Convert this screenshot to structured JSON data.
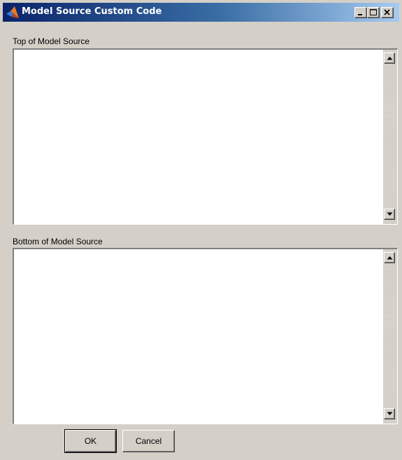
{
  "window": {
    "title": "Model Source Custom Code",
    "icon": "matlab-icon",
    "controls": [
      "minimize-icon",
      "maximize-icon",
      "close-icon"
    ]
  },
  "top_section": {
    "label": "Top of Model Source",
    "value": ""
  },
  "bottom_section": {
    "label": "Bottom of Model Source",
    "value": ""
  },
  "buttons": {
    "ok_label": "OK",
    "cancel_label": "Cancel"
  },
  "colors": {
    "title_bar_start": "#0a246a",
    "title_bar_end": "#a6caf0",
    "window_background": "#d4d0c8"
  }
}
